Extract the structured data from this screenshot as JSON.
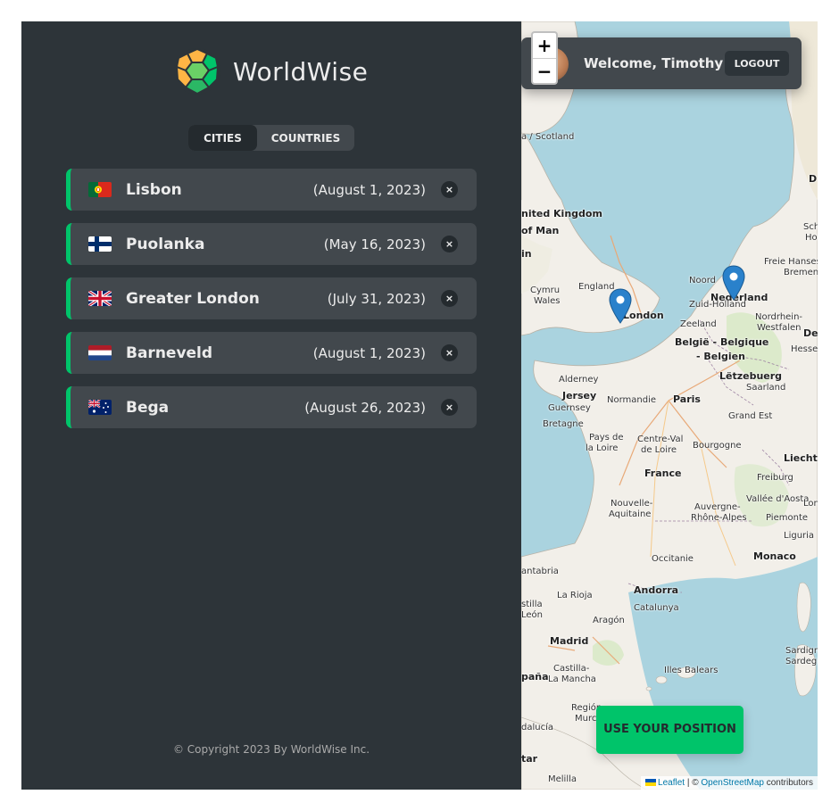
{
  "app": {
    "name": "WorldWise"
  },
  "tabs": [
    {
      "label": "CITIES",
      "active": true
    },
    {
      "label": "COUNTRIES",
      "active": false
    }
  ],
  "cities": [
    {
      "name": "Lisbon",
      "date": "(August 1, 2023)",
      "flag": "portugal-flag"
    },
    {
      "name": "Puolanka",
      "date": "(May 16, 2023)",
      "flag": "finland-flag"
    },
    {
      "name": "Greater London",
      "date": "(July 31, 2023)",
      "flag": "uk-flag"
    },
    {
      "name": "Barneveld",
      "date": "(August 1, 2023)",
      "flag": "netherlands-flag"
    },
    {
      "name": "Bega",
      "date": "(August 26, 2023)",
      "flag": "australia-flag"
    }
  ],
  "delete_label": "×",
  "footer": {
    "copyright": "© Copyright 2023 By WorldWise Inc."
  },
  "map": {
    "zoom_in": "+",
    "zoom_out": "−",
    "user": {
      "welcome": "Welcome, Timothy",
      "logout": "LOGOUT"
    },
    "position_button": "USE YOUR POSITION",
    "attribution": {
      "leaflet": "Leaflet",
      "sep": "| ©",
      "osm": "OpenStreetMap",
      "suffix": "contributors"
    },
    "labels": {
      "scotland": "a / Scotland",
      "uk": "nited Kingdom",
      "of_man": "of Man",
      "in": "in",
      "england": "England",
      "cymru": "Cymru",
      "wales": "Wales",
      "london": "London",
      "nederland": "Nederland",
      "zuid_holland": "Zuid-Holland",
      "noord": "Noord",
      "zeeland": "Zeeland",
      "belgie": "België - Belgique",
      "belgien": "- Belgien",
      "letzebuerg": "Lëtzebuerg",
      "saarland": "Saarland",
      "freie": "Freie Hanseste",
      "bremen": "Bremen",
      "nordrhein": "Nordrhein-",
      "westfalen": "Westfalen",
      "hessen": "Hessen",
      "de": "De",
      "d": "D",
      "schl": "Schl",
      "hol": "Hol",
      "alderney": "Alderney",
      "jersey": "Jersey",
      "guernsey": "Guernsey",
      "normandie": "Normandie",
      "bretagne": "Bretagne",
      "paris": "Paris",
      "grand_est": "Grand Est",
      "pays_de": "Pays de",
      "la_loire": "la Loire",
      "centre_val": "Centre-Val",
      "de_loire": "de Loire",
      "france": "France",
      "bourgogne": "Bourgogne",
      "liechte": "Liechte",
      "freiburg": "Freiburg",
      "vallee": "Vallée d'Aosta",
      "lom": "Lom",
      "piemonte": "Piemonte",
      "liguria": "Liguria",
      "nouvelle": "Nouvelle-",
      "aquitaine": "Aquitaine",
      "auvergne": "Auvergne-",
      "rhone": "Rhône-Alpes",
      "occitanie": "Occitanie",
      "monaco": "Monaco",
      "cantabria": "antabria",
      "la_rioja": "La Rioja",
      "aragon": "Aragón",
      "andorra": "Andorra",
      "catalunya": "Catalunya",
      "stilla": "stilla",
      "leon": "León",
      "madrid": "Madrid",
      "castilla": "Castilla-",
      "la_mancha": "La Mancha",
      "pana": "paña",
      "illes": "Illes Balears",
      "sardigna": "Sardign",
      "sardegna": "Sardegi",
      "region": "Región",
      "murcia": "Murcia",
      "dalucia": "dalucía",
      "tar": "tar",
      "melilla": "Melilla"
    }
  }
}
